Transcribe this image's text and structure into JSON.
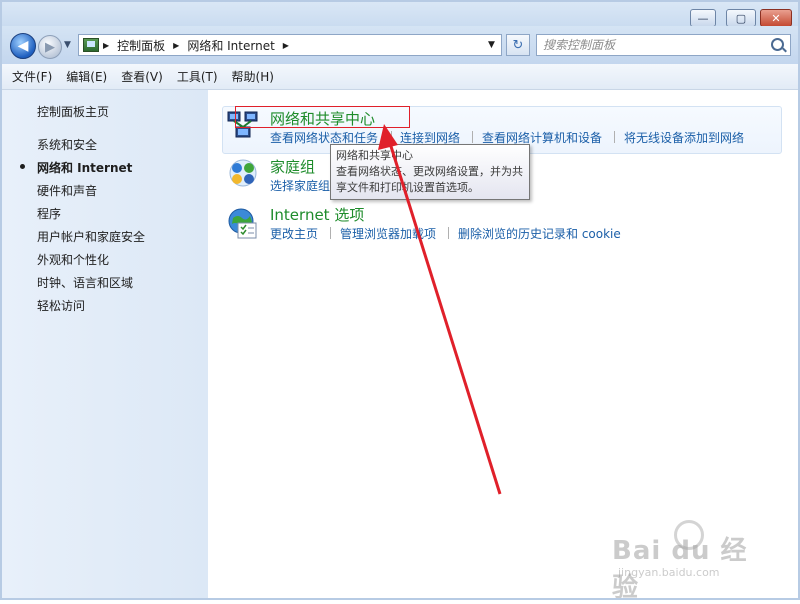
{
  "window": {
    "minimize_glyph": "—",
    "maximize_glyph": "▢",
    "close_glyph": "✕"
  },
  "nav": {
    "back_glyph": "◀",
    "forward_glyph": "▶",
    "breadcrumb": [
      "控制面板",
      "网络和 Internet"
    ],
    "separator": "▶",
    "dropdown_glyph": "▼",
    "refresh_glyph": "↻"
  },
  "search": {
    "placeholder": "搜索控制面板"
  },
  "menubar": {
    "items": [
      "文件(F)",
      "编辑(E)",
      "查看(V)",
      "工具(T)",
      "帮助(H)"
    ]
  },
  "sidebar": {
    "home": "控制面板主页",
    "items": [
      {
        "label": "系统和安全",
        "active": false
      },
      {
        "label": "网络和 Internet",
        "active": true
      },
      {
        "label": "硬件和声音",
        "active": false
      },
      {
        "label": "程序",
        "active": false
      },
      {
        "label": "用户帐户和家庭安全",
        "active": false
      },
      {
        "label": "外观和个性化",
        "active": false
      },
      {
        "label": "时钟、语言和区域",
        "active": false
      },
      {
        "label": "轻松访问",
        "active": false
      }
    ]
  },
  "categories": [
    {
      "title": "网络和共享中心",
      "icon": "network-sharing-icon",
      "links": [
        "查看网络状态和任务",
        "连接到网络",
        "查看网络计算机和设备",
        "将无线设备添加到网络"
      ]
    },
    {
      "title": "家庭组",
      "icon": "homegroup-icon",
      "links": [
        "选择家庭组"
      ]
    },
    {
      "title": "Internet 选项",
      "icon": "internet-options-icon",
      "links": [
        "更改主页",
        "管理浏览器加载项",
        "删除浏览的历史记录和 cookie"
      ]
    }
  ],
  "tooltip": {
    "title": "网络和共享中心",
    "body": "查看网络状态、更改网络设置，并为共享文件和打印机设置首选项。"
  },
  "colors": {
    "category_title": "#1e8c2b",
    "link": "#1b5fa8",
    "highlight_box": "#e0202a",
    "annotation_arrow": "#e0202a"
  },
  "watermark": {
    "logo": "Bai du 经验",
    "url": "jingyan.baidu.com"
  }
}
